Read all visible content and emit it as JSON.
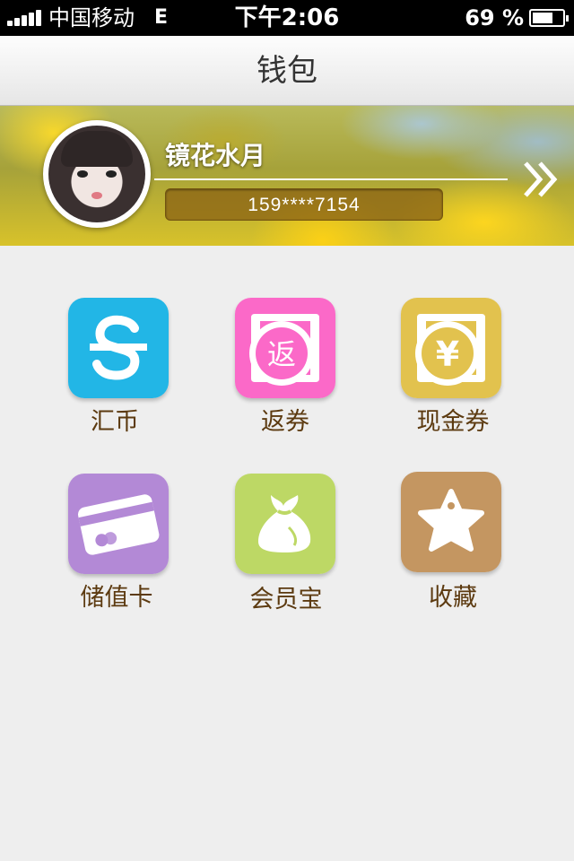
{
  "status_bar": {
    "carrier": "中国移动",
    "network": "E",
    "time": "下午2:06",
    "battery": "69 %",
    "battery_level": 0.69
  },
  "nav": {
    "title": "钱包"
  },
  "profile": {
    "username": "镜花水月",
    "phone": "159****7154",
    "arrow_icon": "double-chevron-right-icon"
  },
  "grid": {
    "items": [
      {
        "label": "汇币",
        "icon": "currency-s-icon",
        "color": "#22b6e6"
      },
      {
        "label": "返券",
        "icon": "rebate-coupon-icon",
        "color": "#fb69c8",
        "glyph": "返"
      },
      {
        "label": "现金券",
        "icon": "yen-coupon-icon",
        "color": "#e2c24e",
        "glyph": "¥"
      },
      {
        "label": "储值卡",
        "icon": "card-icon",
        "color": "#b389d6"
      },
      {
        "label": "会员宝",
        "icon": "money-bag-icon",
        "color": "#bdd865"
      },
      {
        "label": "收藏",
        "icon": "star-tag-icon",
        "color": "#c49661"
      }
    ]
  }
}
